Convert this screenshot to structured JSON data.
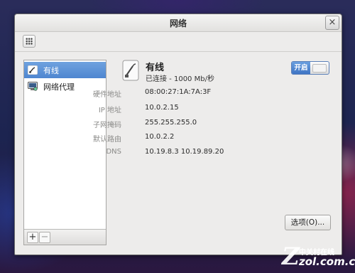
{
  "window": {
    "title": "网络",
    "close_glyph": "×"
  },
  "sidebar": {
    "items": [
      {
        "label": "有线",
        "icon": "wired-network-icon",
        "selected": true
      },
      {
        "label": "网络代理",
        "icon": "proxy-icon",
        "selected": false
      }
    ],
    "add_glyph": "+",
    "remove_glyph": "−"
  },
  "connection": {
    "name": "有线",
    "status": "已连接 - 1000 Mb/秒",
    "toggle_label": "开启",
    "toggle_on": true
  },
  "details": [
    {
      "label": "硬件地址",
      "value": "08:00:27:1A:7A:3F"
    },
    {
      "label": "IP 地址",
      "value": "10.0.2.15"
    },
    {
      "label": "子网掩码",
      "value": "255.255.255.0"
    },
    {
      "label": "默认路由",
      "value": "10.0.2.2"
    },
    {
      "label": "DNS",
      "value": "10.19.8.3 10.19.89.20"
    }
  ],
  "options_label": "选项(O)...",
  "watermark": {
    "cn": "中关村在线",
    "url": "zol.com.cn",
    "logo_letter": "Z"
  },
  "colors": {
    "accent": "#4e86d0",
    "window_bg": "#edeceb"
  }
}
